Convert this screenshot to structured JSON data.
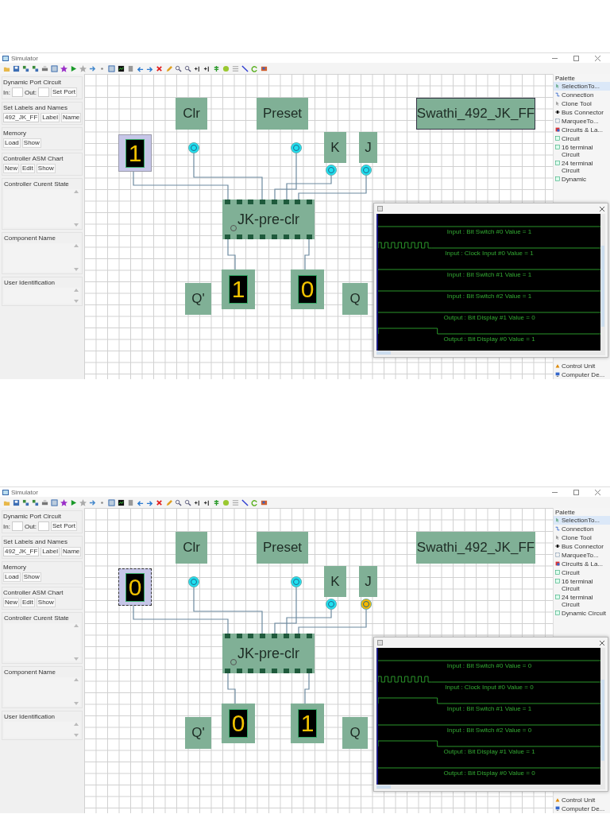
{
  "screens": [
    {
      "window": {
        "title": "Simulator"
      },
      "left_panel": {
        "dynamic_port": {
          "title": "Dynamic Port Circuit",
          "in_label": "In:",
          "out_label": "Out:",
          "button": "Set Port"
        },
        "labels_names": {
          "title": "Set Labels and Names",
          "value": "492_JK_FF",
          "buttons": [
            "Label",
            "Name"
          ]
        },
        "memory": {
          "title": "Memory",
          "buttons": [
            "Load",
            "Show"
          ]
        },
        "asm_chart": {
          "title": "Controller ASM Chart",
          "buttons": [
            "New",
            "Edit",
            "Show"
          ]
        },
        "areas": [
          "Controller Curent State",
          "Component Name",
          "User Identification"
        ]
      },
      "canvas": {
        "labels": [
          {
            "text": "Clr",
            "selected": false
          },
          {
            "text": "Preset",
            "selected": false
          },
          {
            "text": "K",
            "selected": false
          },
          {
            "text": "J",
            "selected": false
          },
          {
            "text": "Q'",
            "selected": false
          },
          {
            "text": "Q",
            "selected": false
          },
          {
            "text": "Swathi_492_JK_FF",
            "selected": true
          }
        ],
        "input_display": {
          "digit": "1",
          "selected": false
        },
        "ports": [
          {
            "on": false
          },
          {
            "on": false
          },
          {
            "on": false
          },
          {
            "on": false
          }
        ],
        "chip": {
          "text": "JK-pre-clr"
        },
        "outputs": [
          {
            "digit": "1"
          },
          {
            "digit": "0"
          }
        ]
      },
      "palette": {
        "title": "Palette",
        "items": [
          {
            "text": "SelectionTo...",
            "kind": "selection",
            "selected": true
          },
          {
            "text": "Connection",
            "kind": "connection",
            "selected": false
          },
          {
            "text": "Clone Tool",
            "kind": "clone",
            "selected": false
          },
          {
            "text": "Bus Connector",
            "kind": "bus",
            "selected": false
          },
          {
            "text": "MarqueeTo...",
            "kind": "marquee",
            "selected": false
          },
          {
            "text": "Circuits & La...",
            "kind": "drawer",
            "selected": false
          },
          {
            "text": "Circuit",
            "kind": "circuit",
            "selected": false
          },
          {
            "text": "16 terminal Circuit",
            "kind": "circuit",
            "selected": false
          },
          {
            "text": "24 terminal Circuit",
            "kind": "circuit",
            "selected": false
          },
          {
            "text": "Dynamic",
            "kind": "circuit",
            "selected": false
          }
        ],
        "bottom_items": [
          {
            "text": "Control Unit",
            "kind": "control"
          },
          {
            "text": "Computer De...",
            "kind": "computer"
          }
        ]
      },
      "waveform_window": {
        "traces": [
          {
            "label": "Input : Bit Switch #0 Value = 1",
            "kind": "flat"
          },
          {
            "label": "Input : Clock Input #0 Value = 1",
            "kind": "clock"
          },
          {
            "label": "Input : Bit Switch #1 Value = 1",
            "kind": "flat"
          },
          {
            "label": "Input : Bit Switch #2 Value = 1",
            "kind": "flat"
          },
          {
            "label": "Output : Bit Display #1 Value = 0",
            "kind": "flat"
          },
          {
            "label": "Output : Bit Display #0 Value = 1",
            "kind": "step_down"
          }
        ]
      }
    },
    {
      "window": {
        "title": "Simulator"
      },
      "left_panel": {
        "dynamic_port": {
          "title": "Dynamic Port Circuit",
          "in_label": "In:",
          "out_label": "Out:",
          "button": "Set Port"
        },
        "labels_names": {
          "title": "Set Labels and Names",
          "value": "492_JK_FF",
          "buttons": [
            "Label",
            "Name"
          ]
        },
        "memory": {
          "title": "Memory",
          "buttons": [
            "Load",
            "Show"
          ]
        },
        "asm_chart": {
          "title": "Controller ASM Chart",
          "buttons": [
            "New",
            "Edit",
            "Show"
          ]
        },
        "areas": [
          "Controller Curent State",
          "Component Name",
          "User Identification"
        ]
      },
      "canvas": {
        "labels": [
          {
            "text": "Clr",
            "selected": false
          },
          {
            "text": "Preset",
            "selected": false
          },
          {
            "text": "K",
            "selected": false
          },
          {
            "text": "J",
            "selected": false
          },
          {
            "text": "Q'",
            "selected": false
          },
          {
            "text": "Q",
            "selected": false
          },
          {
            "text": "Swathi_492_JK_FF",
            "selected": false
          }
        ],
        "input_display": {
          "digit": "0",
          "selected": true
        },
        "ports": [
          {
            "on": false
          },
          {
            "on": false
          },
          {
            "on": false
          },
          {
            "on": true
          }
        ],
        "chip": {
          "text": "JK-pre-clr"
        },
        "outputs": [
          {
            "digit": "0"
          },
          {
            "digit": "1"
          }
        ]
      },
      "palette": {
        "title": "Palette",
        "items": [
          {
            "text": "SelectionTo...",
            "kind": "selection",
            "selected": true
          },
          {
            "text": "Connection",
            "kind": "connection",
            "selected": false
          },
          {
            "text": "Clone Tool",
            "kind": "clone",
            "selected": false
          },
          {
            "text": "Bus Connector",
            "kind": "bus",
            "selected": false
          },
          {
            "text": "MarqueeTo...",
            "kind": "marquee",
            "selected": false
          },
          {
            "text": "Circuits & La...",
            "kind": "drawer",
            "selected": false
          },
          {
            "text": "Circuit",
            "kind": "circuit",
            "selected": false
          },
          {
            "text": "16 terminal Circuit",
            "kind": "circuit",
            "selected": false
          },
          {
            "text": "24 terminal Circuit",
            "kind": "circuit",
            "selected": false
          },
          {
            "text": "Dynamic Circuit",
            "kind": "circuit",
            "selected": false
          }
        ],
        "bottom_items": [
          {
            "text": "Control Unit",
            "kind": "control"
          },
          {
            "text": "Computer De...",
            "kind": "computer"
          }
        ]
      },
      "waveform_window": {
        "traces": [
          {
            "label": "Input : Bit Switch #0 Value = 0",
            "kind": "flat"
          },
          {
            "label": "Input : Clock Input #0 Value = 0",
            "kind": "clock"
          },
          {
            "label": "Input : Bit Switch #1 Value = 1",
            "kind": "step_down"
          },
          {
            "label": "Input : Bit Switch #2 Value = 0",
            "kind": "flat"
          },
          {
            "label": "Output : Bit Display #1 Value = 1",
            "kind": "step_down"
          },
          {
            "label": "Output : Bit Display #0 Value = 0",
            "kind": "flat"
          }
        ]
      }
    }
  ]
}
